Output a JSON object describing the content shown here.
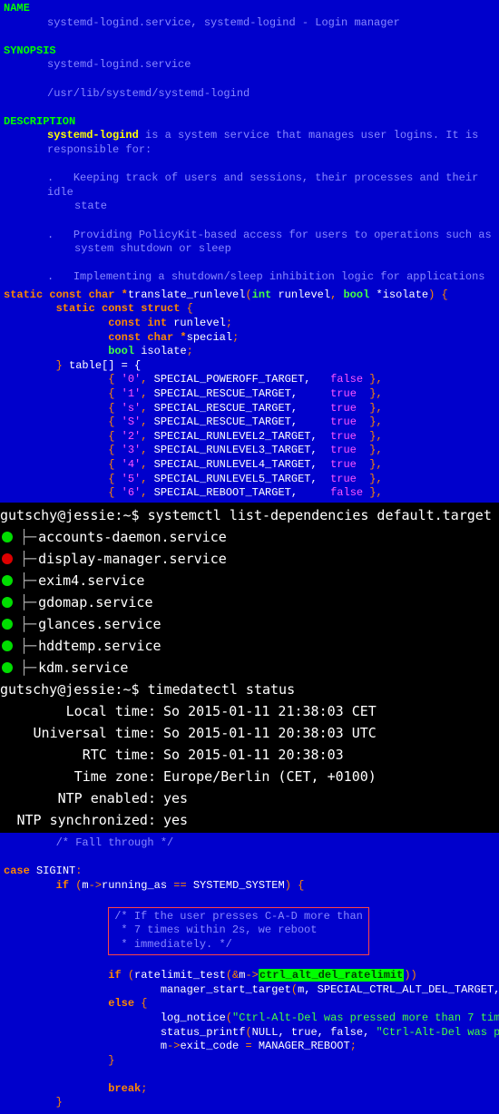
{
  "manpage": {
    "name_header": "NAME",
    "name_line": "systemd-logind.service, systemd-logind - Login manager",
    "synopsis_header": "SYNOPSIS",
    "synopsis_1": "systemd-logind.service",
    "synopsis_2": "/usr/lib/systemd/systemd-logind",
    "desc_header": "DESCRIPTION",
    "desc_key": "systemd-logind",
    "desc_rest": " is a system service that manages user logins. It is",
    "desc_line2": "responsible for:",
    "bullet1a": "Keeping track of users and sessions, their processes and their idle",
    "bullet1b": "state",
    "bullet2a": "Providing PolicyKit-based access for users to operations such as",
    "bullet2b": "system shutdown or sleep",
    "bullet3": "Implementing a shutdown/sleep inhibition logic for applications"
  },
  "code1": {
    "sig_pre": "static const char *",
    "sig_fn": "translate_runlevel",
    "sig_p1t": "int",
    "sig_p1n": " runlevel",
    "sig_p2t": "bool",
    "sig_p2n": " *isolate",
    "struct1": "static const struct",
    "struct2": "const int",
    "struct2n": " runlevel",
    "struct3": "const char *",
    "struct3n": "special",
    "struct4t": "bool",
    "struct4n": " isolate",
    "tableopen": "table[] = {",
    "rows": [
      {
        "ch": "'0'",
        "target": "SPECIAL_POWEROFF_TARGET,",
        "pad": "  ",
        "b": "false"
      },
      {
        "ch": "'1'",
        "target": "SPECIAL_RESCUE_TARGET,",
        "pad": "    ",
        "b": "true "
      },
      {
        "ch": "'s'",
        "target": "SPECIAL_RESCUE_TARGET,",
        "pad": "    ",
        "b": "true "
      },
      {
        "ch": "'S'",
        "target": "SPECIAL_RESCUE_TARGET,",
        "pad": "    ",
        "b": "true "
      },
      {
        "ch": "'2'",
        "target": "SPECIAL_RUNLEVEL2_TARGET,",
        "pad": " ",
        "b": "true "
      },
      {
        "ch": "'3'",
        "target": "SPECIAL_RUNLEVEL3_TARGET,",
        "pad": " ",
        "b": "true "
      },
      {
        "ch": "'4'",
        "target": "SPECIAL_RUNLEVEL4_TARGET,",
        "pad": " ",
        "b": "true "
      },
      {
        "ch": "'5'",
        "target": "SPECIAL_RUNLEVEL5_TARGET,",
        "pad": " ",
        "b": "true "
      },
      {
        "ch": "'6'",
        "target": "SPECIAL_REBOOT_TARGET,",
        "pad": "    ",
        "b": "false"
      }
    ]
  },
  "term": {
    "prompt": "gutschy@jessie:~$",
    "cmd1": "systemctl list-dependencies default.target",
    "services": [
      {
        "dot": "green",
        "name": "accounts-daemon.service"
      },
      {
        "dot": "red",
        "name": "display-manager.service"
      },
      {
        "dot": "green",
        "name": "exim4.service"
      },
      {
        "dot": "green",
        "name": "gdomap.service"
      },
      {
        "dot": "green",
        "name": "glances.service"
      },
      {
        "dot": "green",
        "name": "hddtemp.service"
      },
      {
        "dot": "green",
        "name": "kdm.service"
      }
    ],
    "cmd2": "timedatectl status",
    "kv": [
      {
        "k": "Local time:",
        "v": "So 2015-01-11 21:38:03 CET"
      },
      {
        "k": "Universal time:",
        "v": "So 2015-01-11 20:38:03 UTC"
      },
      {
        "k": "RTC time:",
        "v": "So 2015-01-11 20:38:03"
      },
      {
        "k": "Time zone:",
        "v": "Europe/Berlin (CET, +0100)"
      },
      {
        "k": "NTP enabled:",
        "v": "yes"
      },
      {
        "k": "NTP synchronized:",
        "v": "yes"
      }
    ]
  },
  "code2": {
    "fallthrough": "/* Fall through */",
    "case": "case",
    "sigint": " SIGINT",
    "running_as": "running_as",
    "sysd": "SYSTEMD_SYSTEM",
    "comment_l1": "/* If the user presses C-A-D more than",
    "comment_l2": " * 7 times within 2s, we reboot",
    "comment_l3": " * immediately. */",
    "ratelimit_fn": "ratelimit_test",
    "ratelimit_var": "ctrl_alt_del_ratelimit",
    "mst": "manager_start_target",
    "mst_arg": "m, SPECIAL_CTRL_ALT_DEL_TARGET,",
    "else": "else",
    "lognotice_fn": "log_notice",
    "lognotice_str": "\"Ctrl-Alt-Del was pressed more than 7 tim",
    "statusprintf_fn": "status_printf",
    "statusprintf_args": "NULL, true, false, ",
    "statusprintf_str": "\"Ctrl-Alt-Del was p",
    "exitcode": "exit_code",
    "mgr_reboot": "MANAGER_REBOOT",
    "break": "break"
  }
}
